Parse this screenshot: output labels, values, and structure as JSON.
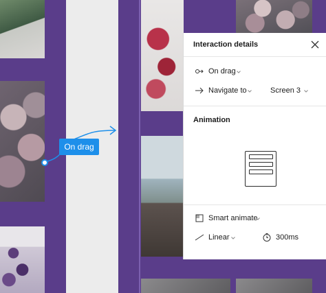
{
  "trigger_badge": "On drag",
  "panel": {
    "title": "Interaction details",
    "trigger": "On drag",
    "action": "Navigate to",
    "destination": "Screen 3",
    "animation_title": "Animation",
    "animation_type": "Smart animate",
    "easing": "Linear",
    "duration": "300ms"
  },
  "icons": {
    "close": "close-icon",
    "trigger": "drag-trigger-icon",
    "navigate": "arrow-right-icon",
    "smart_animate": "smart-animate-icon",
    "easing": "linear-ease-icon",
    "duration": "timer-icon",
    "chevron": "chevron-down-icon"
  },
  "colors": {
    "canvas": "#5a3d8a",
    "badge": "#1d8fea",
    "panel": "#ffffff"
  }
}
